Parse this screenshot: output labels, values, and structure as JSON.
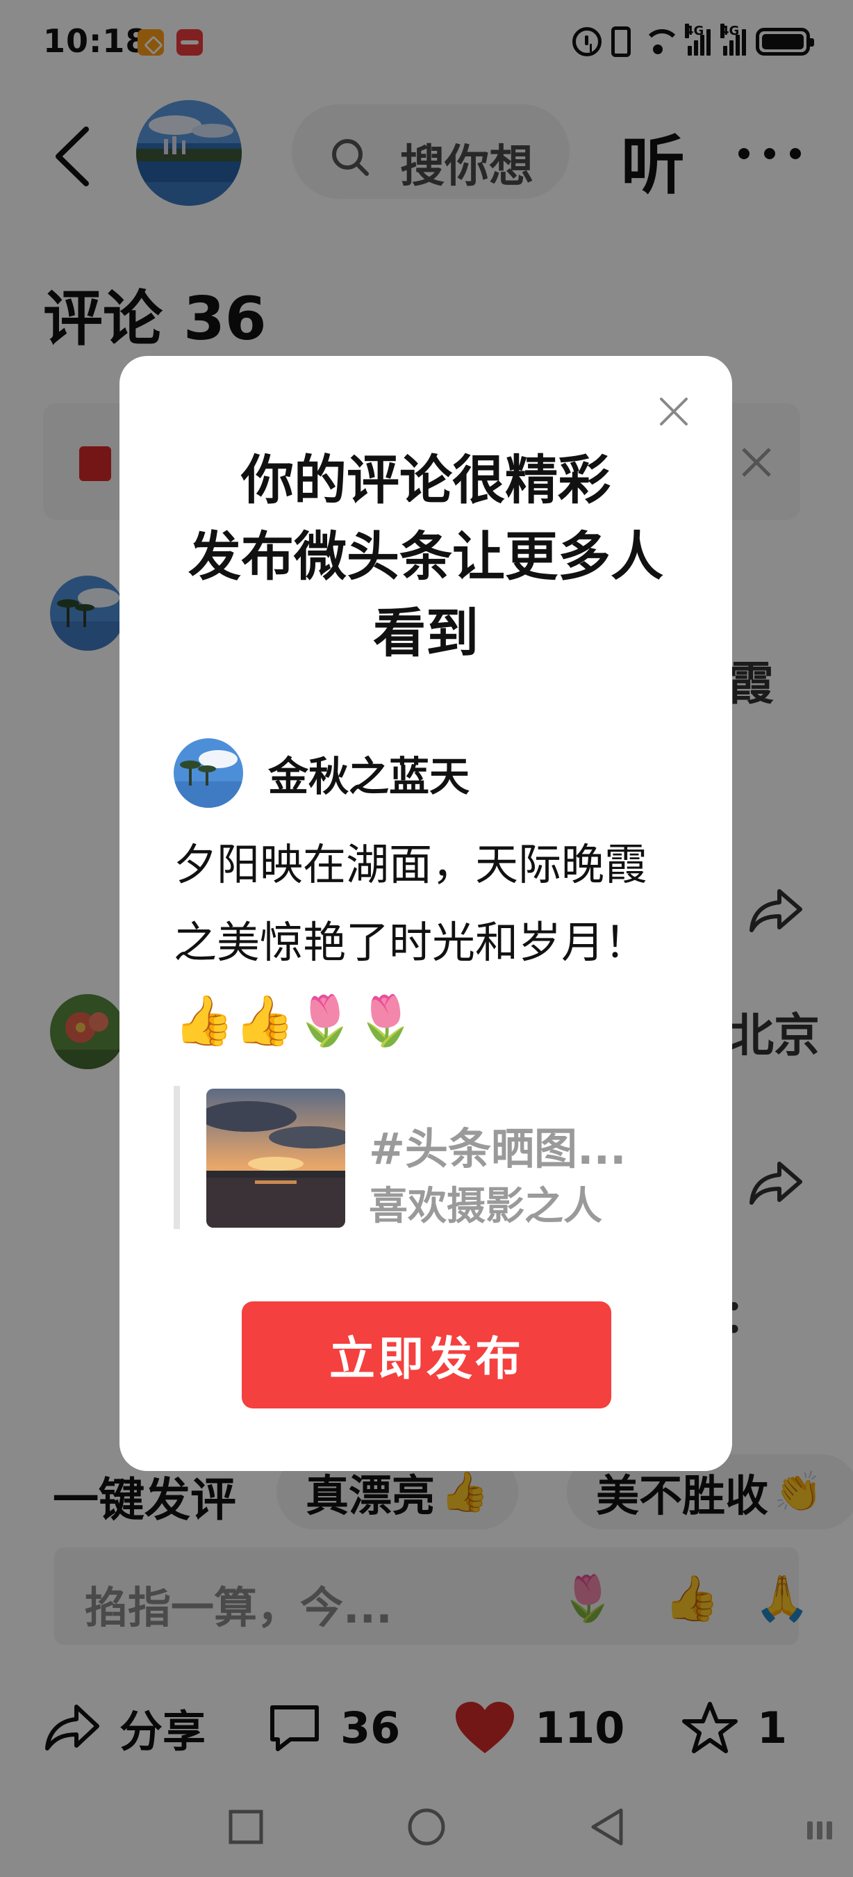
{
  "status_bar": {
    "time": "10:18",
    "signal_1": "4G",
    "signal_2": "4G",
    "wifi_label": "6"
  },
  "header": {
    "search_text": "搜你想",
    "listen_label": "听",
    "more_label": ""
  },
  "comments": {
    "title": "评论 36",
    "edge_texts": [
      "霞",
      "北京",
      "："
    ]
  },
  "quick_replies": {
    "label": "一键发评",
    "chips": [
      {
        "text": "真漂亮",
        "emoji": "👍"
      },
      {
        "text": "美不胜收",
        "emoji": "👏"
      }
    ]
  },
  "comment_input": {
    "placeholder": "掐指一算，今...",
    "emojis": [
      "🌷",
      "👍",
      "🙏"
    ]
  },
  "action_bar": {
    "share_label": "分享",
    "comment_count": "36",
    "like_count": "110",
    "fav_count": "1"
  },
  "dialog": {
    "title_line_1": "你的评论很精彩",
    "title_line_2": "发布微头条让更多人",
    "title_line_3": "看到",
    "author_name": "金秋之蓝天",
    "comment_text": "夕阳映在湖面，天际晚霞之美惊艳了时光和岁月！",
    "comment_emojis": [
      "👍",
      "👍",
      "🌷",
      "🌷"
    ],
    "quote_title": "#头条晒图...",
    "quote_author": "喜欢摄影之人",
    "publish_button": "立即发布"
  },
  "colors": {
    "primary_red": "#f4403e",
    "overlay": "rgba(0,0,0,0.46)",
    "like_red": "#d42a2a"
  }
}
